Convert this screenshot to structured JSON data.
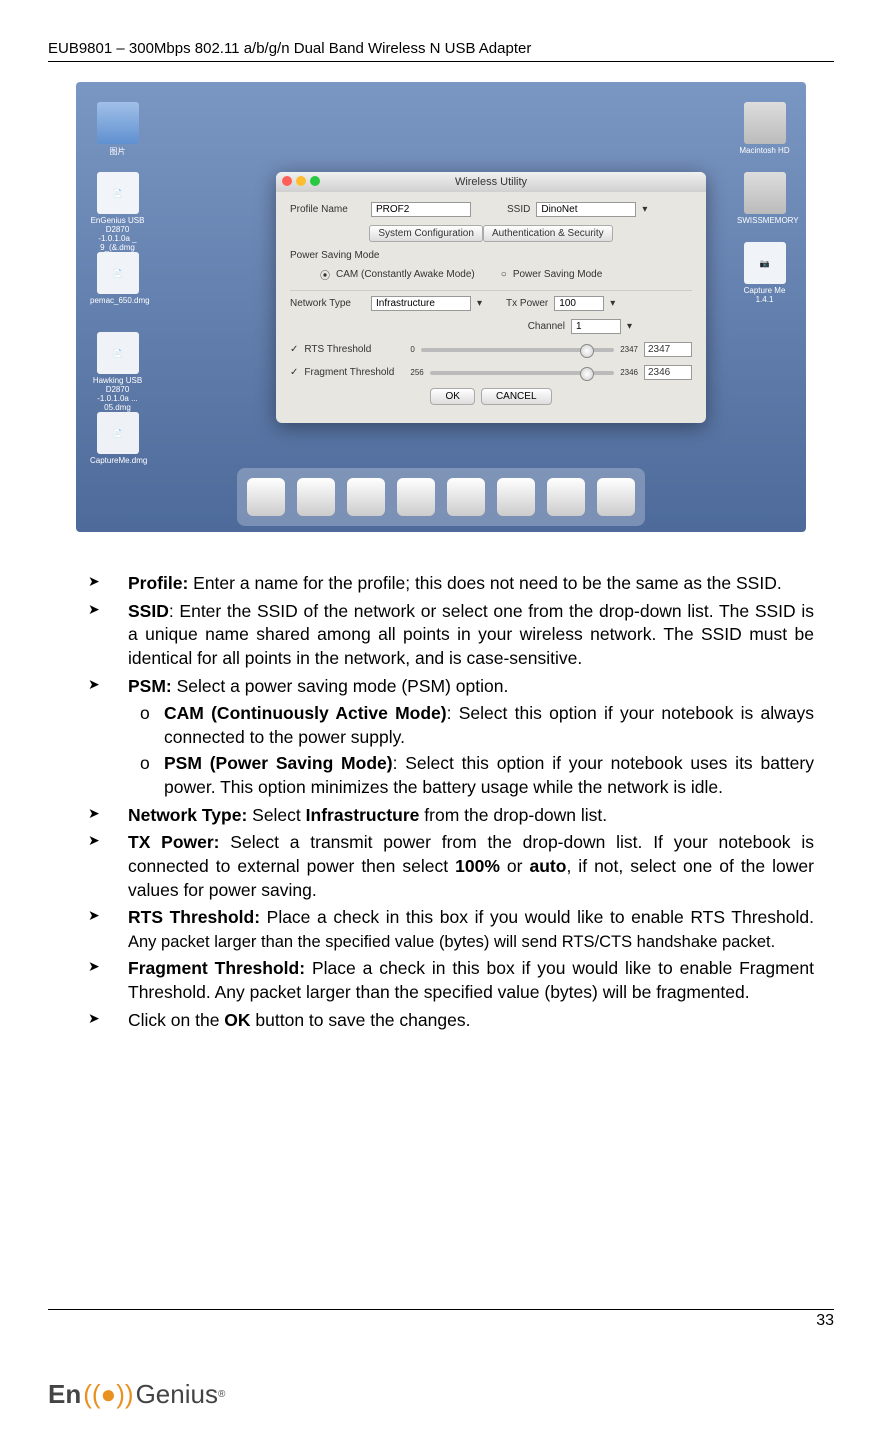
{
  "header": "EUB9801 – 300Mbps 802.11 a/b/g/n Dual Band Wireless N USB Adapter",
  "page_number": "33",
  "footer_brand": "EnGenius",
  "screenshot": {
    "desktop_icons_left": [
      {
        "label": "图片"
      },
      {
        "label": "EnGenius USB D2870 -1.0.1.0a _ 9_(&.dmg"
      },
      {
        "label": "pemac_650.dmg"
      },
      {
        "label": "Hawking USB D2870 -1.0.1.0a ... 05.dmg"
      },
      {
        "label": "CaptureMe.dmg"
      }
    ],
    "desktop_icons_right": [
      {
        "label": "Macintosh HD"
      },
      {
        "label": "SWISSMEMORY"
      },
      {
        "label": "Capture Me 1.4.1"
      }
    ],
    "dialog": {
      "title": "Wireless Utility",
      "profile_label": "Profile Name",
      "profile_value": "PROF2",
      "ssid_label": "SSID",
      "ssid_value": "DinoNet",
      "tab1": "System Configuration",
      "tab2": "Authentication & Security",
      "psm_label": "Power Saving Mode",
      "cam_label": "CAM (Constantly Awake Mode)",
      "psm_option_label": "Power Saving Mode",
      "network_type_label": "Network Type",
      "network_type_value": "Infrastructure",
      "tx_power_label": "Tx Power",
      "tx_power_value": "100",
      "channel_label": "Channel",
      "channel_value": "1",
      "rts_check": "RTS Threshold",
      "rts_min": "0",
      "rts_max": "2347",
      "rts_value": "2347",
      "frag_check": "Fragment Threshold",
      "frag_min": "256",
      "frag_max": "2346",
      "frag_value": "2346",
      "ok": "OK",
      "cancel": "CANCEL"
    }
  },
  "bullets": {
    "profile": {
      "head": "Profile: ",
      "text": "Enter a name for the profile; this does not need to be the same as the SSID."
    },
    "ssid": {
      "head": "SSID",
      "text": ": Enter the SSID of the network or select one from the drop-down list. The SSID is a unique name shared among all points in your wireless network. The SSID must be identical for all points in the network, and is case-sensitive."
    },
    "psm": {
      "head": "PSM: ",
      "text": "Select a power saving mode (PSM) option."
    },
    "cam": {
      "head": "CAM (Continuously Active Mode)",
      "text": ": Select this option if your notebook is always connected to the power supply."
    },
    "psm_sub": {
      "head": "PSM (Power Saving Mode)",
      "text": ": Select this option if your notebook uses its battery power. This option minimizes the battery usage while the network is idle."
    },
    "network": {
      "head": "Network Type: ",
      "text1": "Select ",
      "bold1": "Infrastructure",
      "text2": " from the drop-down list."
    },
    "tx": {
      "head": "TX Power: ",
      "text1": "Select a transmit power from the drop-down list. If your notebook is connected to external power then select ",
      "bold1": "100%",
      "text2": " or ",
      "bold2": "auto",
      "text3": ", if not, select one of the lower values for power saving."
    },
    "rts": {
      "head": "RTS Threshold: ",
      "text1": "Place a check in this box if you would like to enable RTS Threshold. ",
      "small": "Any packet larger than the specified value (bytes) will send RTS/CTS handshake packet."
    },
    "frag": {
      "head": "Fragment Threshold: ",
      "text": "Place a check in this box if you would like to enable Fragment Threshold. Any packet larger than the specified value (bytes) will be fragmented."
    },
    "ok": {
      "text1": "Click on the ",
      "bold1": "OK",
      "text2": " button to save the changes."
    }
  }
}
